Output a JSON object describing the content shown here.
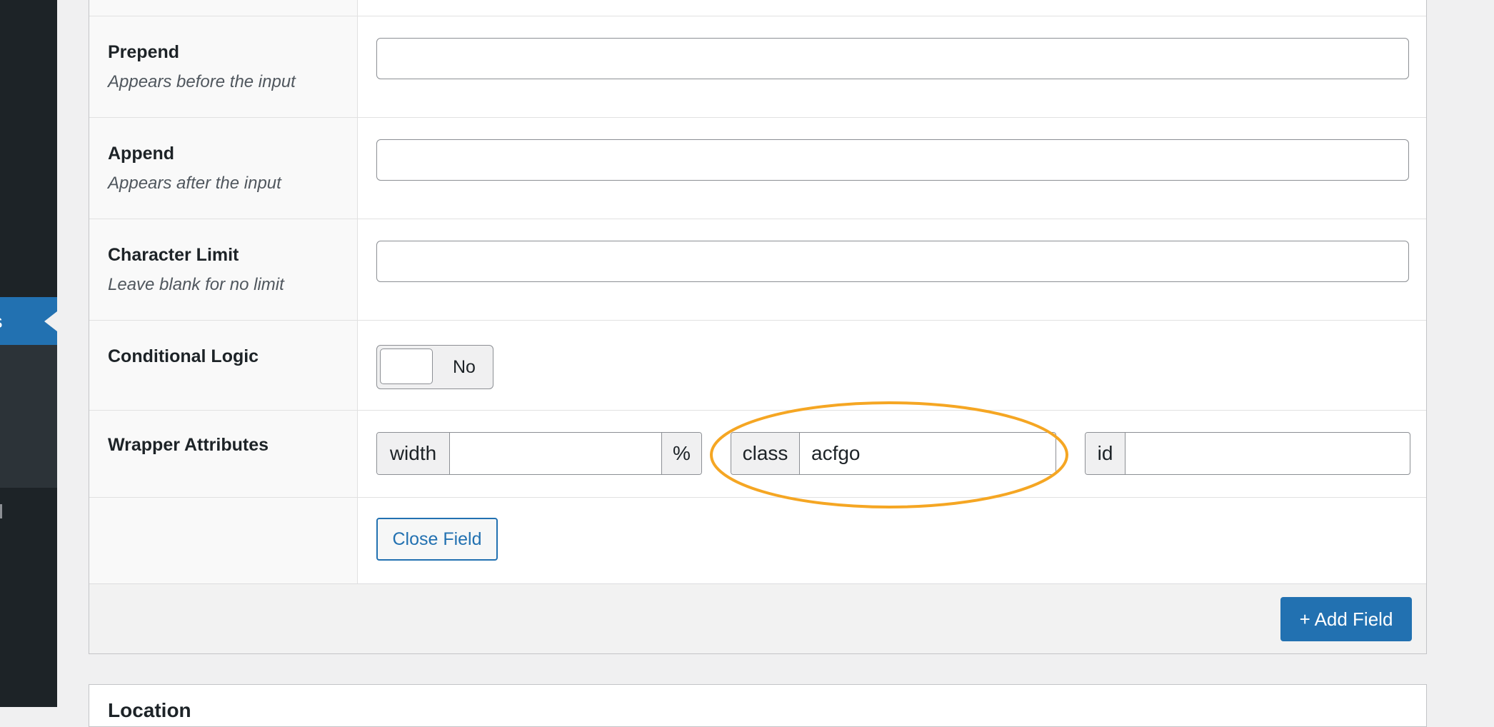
{
  "sidebar": {
    "current_item_label": "s"
  },
  "settings": {
    "prepend": {
      "label": "Prepend",
      "description": "Appears before the input",
      "value": ""
    },
    "append": {
      "label": "Append",
      "description": "Appears after the input",
      "value": ""
    },
    "character_limit": {
      "label": "Character Limit",
      "description": "Leave blank for no limit",
      "value": ""
    },
    "conditional_logic": {
      "label": "Conditional Logic",
      "toggle_text": "No"
    },
    "wrapper_attributes": {
      "label": "Wrapper Attributes",
      "width": {
        "prefix": "width",
        "value": "",
        "suffix": "%"
      },
      "class": {
        "prefix": "class",
        "value": "acfgo"
      },
      "id": {
        "prefix": "id",
        "value": ""
      }
    }
  },
  "actions": {
    "close_field": "Close Field",
    "add_field": "+ Add Field"
  },
  "next_section": {
    "title": "Location"
  },
  "colors": {
    "highlight": "#f5a623",
    "primary": "#2271b1",
    "sidebar": "#1d2327"
  }
}
